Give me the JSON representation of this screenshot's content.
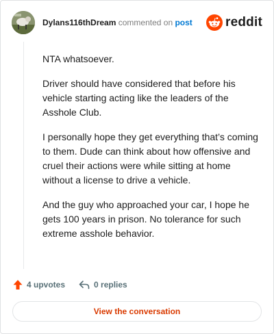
{
  "header": {
    "username": "Dylans116thDream",
    "action_text": "commented on",
    "link_text": "post",
    "brand": "reddit"
  },
  "comment": {
    "paragraphs": [
      "NTA whatsoever.",
      "Driver should have considered that before his vehicle starting acting like the leaders of the Asshole Club.",
      "I personally hope they get everything that’s coming to them. Dude can think about how offensive and cruel their actions were while sitting at home without a license to drive a vehicle.",
      "And the guy who approached your car, I hope he gets 100 years in prison. No tolerance for such extreme asshole behavior."
    ]
  },
  "actions": {
    "upvotes_label": "4 upvotes",
    "replies_label": "0 replies"
  },
  "footer": {
    "button_label": "View the conversation"
  },
  "icons": {
    "upvote": "upvote-arrow-icon",
    "reply": "reply-arrow-icon",
    "brand": "reddit-snoo-icon"
  },
  "colors": {
    "accent": "#ff4500",
    "link": "#0079d3",
    "button_text": "#d93a00"
  }
}
